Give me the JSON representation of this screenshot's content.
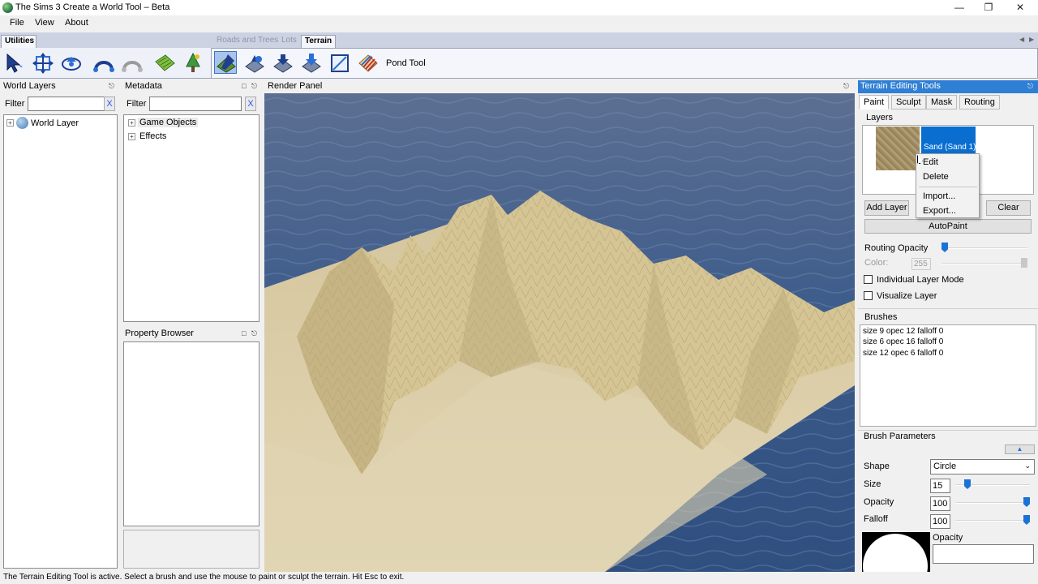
{
  "window": {
    "title": "The Sims 3 Create a World Tool – Beta",
    "controls": [
      "—",
      "❐",
      "✕"
    ]
  },
  "menu": [
    "File",
    "View",
    "About"
  ],
  "tabs": {
    "left": "Utilities",
    "middle": [
      "Roads and Trees",
      "Lots",
      "Terrain"
    ]
  },
  "toolbar": {
    "active_tool_label": "Pond Tool",
    "tools": [
      "select-icon",
      "move-icon",
      "rotate-icon",
      "road-icon",
      "road-grey-icon",
      "lot-icon",
      "tree-icon",
      "terrain-paint-icon",
      "terrain-raise-icon",
      "terrain-flatten-icon",
      "terrain-lower-icon",
      "terrain-bounds-icon",
      "terrain-layers-icon"
    ]
  },
  "world_layers": {
    "title": "World Layers",
    "filter_label": "Filter",
    "filter_x": "X",
    "items": [
      "World Layer"
    ]
  },
  "metadata": {
    "title": "Metadata",
    "filter_label": "Filter",
    "filter_x": "X",
    "items": [
      "Game Objects",
      "Effects"
    ]
  },
  "property_browser": {
    "title": "Property Browser"
  },
  "render_panel": {
    "title": "Render Panel"
  },
  "terrain_tools": {
    "title": "Terrain Editing Tools",
    "tabs": [
      "Paint",
      "Sculpt",
      "Mask",
      "Routing"
    ],
    "layers_label": "Layers",
    "selected_layer": "Sand (Sand 1)",
    "add_layer": "Add Layer",
    "clear": "Clear",
    "autopaint": "AutoPaint",
    "routing_opacity_label": "Routing Opacity",
    "routing_opacity": 0.0,
    "color_label": "Color:",
    "color_value": "255",
    "individual_layer_mode": "Individual Layer Mode",
    "visualize_layer": "Visualize Layer",
    "brushes_label": "Brushes",
    "brushes": [
      "size 9  opec 12  falloff 0",
      "size 6  opec 16  falloff 0",
      "size 12  opec 6  falloff 0"
    ],
    "brush_params_label": "Brush Parameters",
    "shape_label": "Shape",
    "shape_value": "Circle",
    "size_label": "Size",
    "size_value": "15",
    "opacity_label": "Opacity",
    "opacity_value": "100",
    "falloff_label": "Falloff",
    "falloff_value": "100",
    "preview_opacity_label": "Opacity"
  },
  "context_menu": {
    "items": [
      "Edit",
      "Delete",
      "Import...",
      "Export..."
    ]
  },
  "status": "The Terrain Editing Tool is active. Select a brush and use the mouse to paint or sculpt the terrain. Hit Esc to exit.",
  "colors": {
    "accent": "#2f7fd4",
    "water": "#35527f",
    "sand": "#d8c79a"
  }
}
